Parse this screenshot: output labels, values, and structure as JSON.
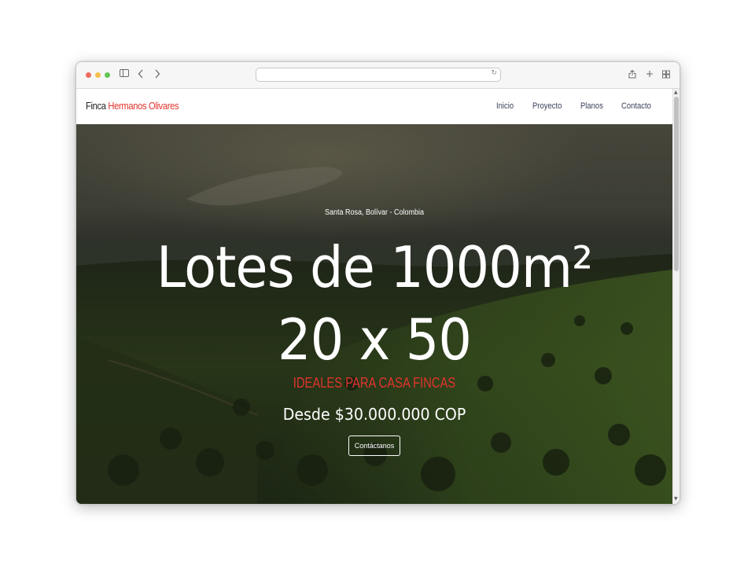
{
  "browser": {
    "address_value": "",
    "icons": [
      "sidebar-icon",
      "back-icon",
      "forward-icon",
      "reload-icon",
      "share-icon",
      "new-tab-icon",
      "tab-overview-icon"
    ]
  },
  "site": {
    "brand_part1": "Finca",
    "brand_part2": "Hermanos Olivares",
    "nav": [
      "Inicio",
      "Proyecto",
      "Planos",
      "Contacto"
    ]
  },
  "hero": {
    "location": "Santa Rosa, Bolívar - Colombia",
    "headline_line1": "Lotes de 1000m²",
    "headline_line2": "20 x 50",
    "tagline": "IDEALES PARA CASA FINCAS",
    "price": "Desde $30.000.000 COP",
    "cta_label": "Contáctanos"
  },
  "colors": {
    "accent": "#e0342e",
    "nav_text": "#3a3f58"
  }
}
